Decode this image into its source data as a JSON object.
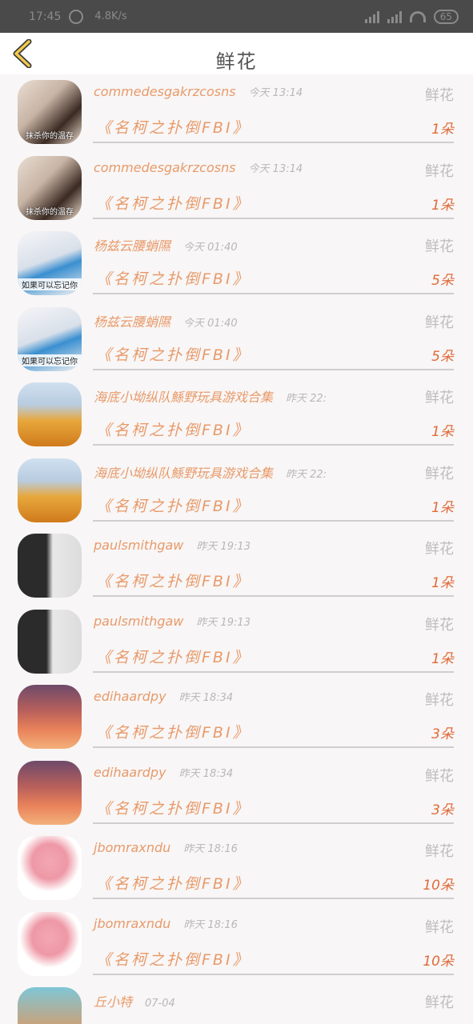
{
  "status": {
    "time": "17:45",
    "speed": "4.8K/s",
    "battery": "65"
  },
  "header": {
    "title": "鲜花"
  },
  "rows": [
    {
      "name": "commedesgakrzcosns",
      "time": "今天 13:14",
      "type": "鲜花",
      "work": "《名柯之扑倒FBI》",
      "count": "1朵",
      "avatar_caption": "抹杀你的温存",
      "avatar_style": "a"
    },
    {
      "name": "commedesgakrzcosns",
      "time": "今天 13:14",
      "type": "鲜花",
      "work": "《名柯之扑倒FBI》",
      "count": "1朵",
      "avatar_caption": "抹杀你的温存",
      "avatar_style": "a"
    },
    {
      "name": "杨兹云腰蛸隰",
      "time": "今天 01:40",
      "type": "鲜花",
      "work": "《名柯之扑倒FBI》",
      "count": "5朵",
      "avatar_caption": "如果可以忘记你",
      "avatar_style": "b"
    },
    {
      "name": "杨兹云腰蛸隰",
      "time": "今天 01:40",
      "type": "鲜花",
      "work": "《名柯之扑倒FBI》",
      "count": "5朵",
      "avatar_caption": "如果可以忘记你",
      "avatar_style": "b"
    },
    {
      "name": "海底小坳纵队鯀野玩具游戏合集",
      "time": "昨天 22:",
      "type": "鲜花",
      "work": "《名柯之扑倒FBI》",
      "count": "1朵",
      "avatar_caption": "",
      "avatar_style": "c"
    },
    {
      "name": "海底小坳纵队鯀野玩具游戏合集",
      "time": "昨天 22:",
      "type": "鲜花",
      "work": "《名柯之扑倒FBI》",
      "count": "1朵",
      "avatar_caption": "",
      "avatar_style": "c"
    },
    {
      "name": "paulsmithgaw",
      "time": "昨天 19:13",
      "type": "鲜花",
      "work": "《名柯之扑倒FBI》",
      "count": "1朵",
      "avatar_caption": "",
      "avatar_style": "d"
    },
    {
      "name": "paulsmithgaw",
      "time": "昨天 19:13",
      "type": "鲜花",
      "work": "《名柯之扑倒FBI》",
      "count": "1朵",
      "avatar_caption": "",
      "avatar_style": "d"
    },
    {
      "name": "edihaardpy",
      "time": "昨天 18:34",
      "type": "鲜花",
      "work": "《名柯之扑倒FBI》",
      "count": "3朵",
      "avatar_caption": "",
      "avatar_style": "e"
    },
    {
      "name": "edihaardpy",
      "time": "昨天 18:34",
      "type": "鲜花",
      "work": "《名柯之扑倒FBI》",
      "count": "3朵",
      "avatar_caption": "",
      "avatar_style": "e"
    },
    {
      "name": "jbomraxndu",
      "time": "昨天 18:16",
      "type": "鲜花",
      "work": "《名柯之扑倒FBI》",
      "count": "10朵",
      "avatar_caption": "",
      "avatar_style": "f"
    },
    {
      "name": "jbomraxndu",
      "time": "昨天 18:16",
      "type": "鲜花",
      "work": "《名柯之扑倒FBI》",
      "count": "10朵",
      "avatar_caption": "",
      "avatar_style": "f"
    },
    {
      "name": "丘小特",
      "time": "07-04",
      "type": "鲜花",
      "work": "",
      "count": "",
      "avatar_caption": "",
      "avatar_style": "g"
    }
  ]
}
